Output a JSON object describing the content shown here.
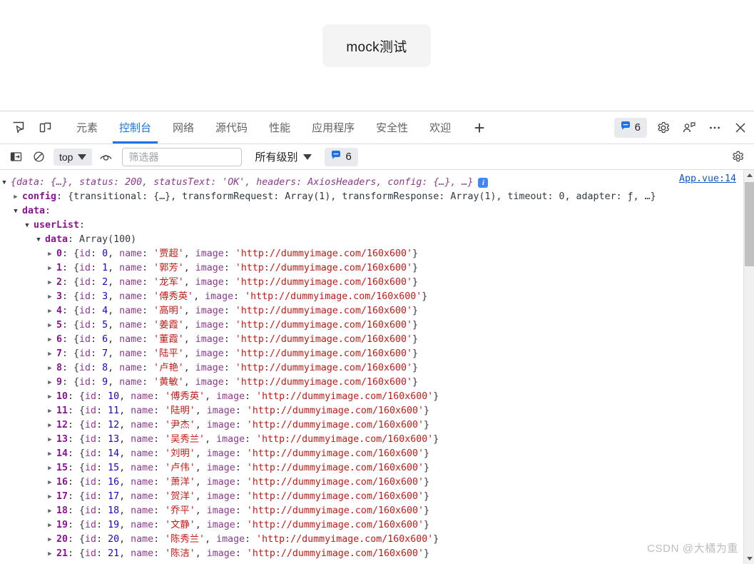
{
  "page": {
    "mock_button_label": "mock测试"
  },
  "devtools": {
    "tabs": [
      {
        "label": "元素",
        "active": false
      },
      {
        "label": "控制台",
        "active": true
      },
      {
        "label": "网络",
        "active": false
      },
      {
        "label": "源代码",
        "active": false
      },
      {
        "label": "性能",
        "active": false
      },
      {
        "label": "应用程序",
        "active": false
      },
      {
        "label": "安全性",
        "active": false
      },
      {
        "label": "欢迎",
        "active": false
      }
    ],
    "new_tab_label": "+",
    "message_count": "6",
    "icons": {
      "inspect": "inspect-element-icon",
      "device": "device-toolbar-icon",
      "settings": "gear-icon",
      "account": "account-icon",
      "more": "more-options-icon",
      "close": "close-icon"
    }
  },
  "console_toolbar": {
    "sidebar_toggle": "console-sidebar-icon",
    "clear_console": "clear-console-icon",
    "context": "top",
    "eye_icon": "live-expression-icon",
    "filter_placeholder": "筛选器",
    "filter_value": "",
    "level": "所有级别",
    "message_count": "6",
    "settings": "gear-icon"
  },
  "console": {
    "source_link": "App.vue:14",
    "root": {
      "preview_prefix": "{",
      "preview": "data: {…}, status: 200, statusText: 'OK', headers: AxiosHeaders, config: {…}, …",
      "preview_suffix": "}",
      "info_badge": "i"
    },
    "config_row": {
      "key": "config",
      "value": "{transitional: {…}, transformRequest: Array(1), transformResponse: Array(1), timeout: 0, adapter: ƒ, …}"
    },
    "data_row": {
      "key": "data"
    },
    "userlist_row": {
      "key": "userList"
    },
    "inner_data_row": {
      "key": "data",
      "value": "Array(100)"
    },
    "image_url": "http://dummyimage.com/160x600",
    "entries": [
      {
        "index": "0",
        "id": "0",
        "name": "贾超"
      },
      {
        "index": "1",
        "id": "1",
        "name": "郭芳"
      },
      {
        "index": "2",
        "id": "2",
        "name": "龙军"
      },
      {
        "index": "3",
        "id": "3",
        "name": "傅秀英"
      },
      {
        "index": "4",
        "id": "4",
        "name": "高明"
      },
      {
        "index": "5",
        "id": "5",
        "name": "姜霞"
      },
      {
        "index": "6",
        "id": "6",
        "name": "董霞"
      },
      {
        "index": "7",
        "id": "7",
        "name": "陆平"
      },
      {
        "index": "8",
        "id": "8",
        "name": "卢艳"
      },
      {
        "index": "9",
        "id": "9",
        "name": "黄敏"
      },
      {
        "index": "10",
        "id": "10",
        "name": "傅秀英"
      },
      {
        "index": "11",
        "id": "11",
        "name": "陆明"
      },
      {
        "index": "12",
        "id": "12",
        "name": "尹杰"
      },
      {
        "index": "13",
        "id": "13",
        "name": "吴秀兰"
      },
      {
        "index": "14",
        "id": "14",
        "name": "刘明"
      },
      {
        "index": "15",
        "id": "15",
        "name": "卢伟"
      },
      {
        "index": "16",
        "id": "16",
        "name": "萧洋"
      },
      {
        "index": "17",
        "id": "17",
        "name": "贺洋"
      },
      {
        "index": "18",
        "id": "18",
        "name": "乔平"
      },
      {
        "index": "19",
        "id": "19",
        "name": "文静"
      },
      {
        "index": "20",
        "id": "20",
        "name": "陈秀兰"
      },
      {
        "index": "21",
        "id": "21",
        "name": "陈洁"
      }
    ]
  },
  "watermark": "CSDN @大橘为重",
  "colors": {
    "accent": "#1a73e8",
    "link": "#1155cc",
    "badge_blue": "#4285f4",
    "property": "#881391",
    "string": "#c41a16",
    "number": "#1c00cf"
  }
}
